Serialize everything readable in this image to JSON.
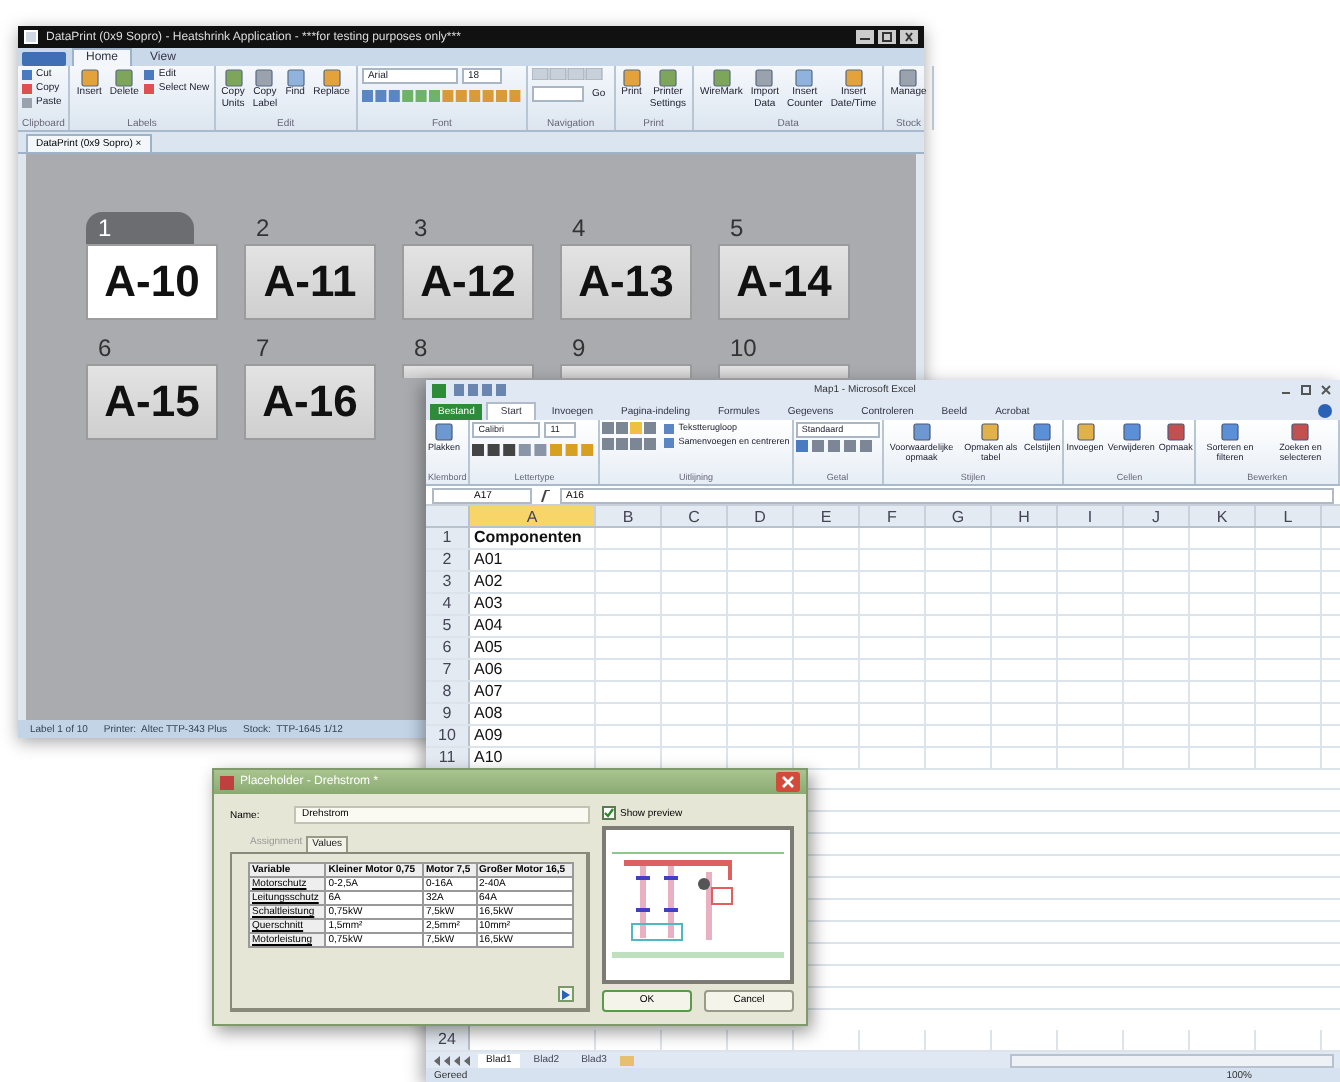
{
  "dataprint": {
    "title": "DataPrint (0x9 Sopro) - Heatshrink Application - ***for testing purposes only***",
    "tabs": [
      {
        "label": "Home",
        "selected": true
      },
      {
        "label": "View",
        "selected": false
      }
    ],
    "ribbon": [
      {
        "label": "Clipboard",
        "items": [
          {
            "kind": "stack",
            "labels": [
              "Cut",
              "Copy",
              "Paste"
            ]
          }
        ]
      },
      {
        "label": "Labels",
        "items": [
          {
            "kind": "large",
            "label": "Insert"
          },
          {
            "kind": "large",
            "label": "Delete"
          },
          {
            "kind": "stack",
            "labels": [
              "Edit",
              "Select New"
            ]
          }
        ]
      },
      {
        "label": "Edit",
        "items": [
          {
            "kind": "large",
            "label": "Copy Units"
          },
          {
            "kind": "large",
            "label": "Copy Label"
          },
          {
            "kind": "large",
            "label": "Find"
          },
          {
            "kind": "large",
            "label": "Replace"
          }
        ]
      },
      {
        "label": "Font",
        "items": [
          {
            "kind": "font",
            "font": "Arial",
            "size": "18"
          }
        ]
      },
      {
        "label": "Navigation",
        "items": [
          {
            "kind": "nav",
            "button": "Go"
          }
        ]
      },
      {
        "label": "Print",
        "items": [
          {
            "kind": "large",
            "label": "Print"
          },
          {
            "kind": "large",
            "label": "Printer Settings"
          }
        ]
      },
      {
        "label": "Data",
        "items": [
          {
            "kind": "large",
            "label": "WireMark"
          },
          {
            "kind": "large",
            "label": "Import Data"
          },
          {
            "kind": "large",
            "label": "Insert Counter"
          },
          {
            "kind": "large",
            "label": "Insert Date/Time"
          }
        ]
      },
      {
        "label": "Stock",
        "items": [
          {
            "kind": "large",
            "label": "Manage"
          }
        ]
      }
    ],
    "document_tab": "DataPrint (0x9 Sopro)",
    "document_tab_close": "×",
    "labels": [
      {
        "number": "1",
        "text": "A-10",
        "selected": true
      },
      {
        "number": "2",
        "text": "A-11",
        "selected": false
      },
      {
        "number": "3",
        "text": "A-12",
        "selected": false
      },
      {
        "number": "4",
        "text": "A-13",
        "selected": false
      },
      {
        "number": "5",
        "text": "A-14",
        "selected": false
      },
      {
        "number": "6",
        "text": "A-15",
        "selected": false
      },
      {
        "number": "7",
        "text": "A-16",
        "selected": false
      },
      {
        "number": "8",
        "selected": false
      },
      {
        "number": "9",
        "selected": false
      },
      {
        "number": "10",
        "selected": false
      }
    ],
    "status_bar": [
      "Label 1 of 10",
      "Printer:  Altec TTP-343 Plus",
      "Stock:  TTP-1645 1/12"
    ]
  },
  "excel": {
    "title": "Map1 - Microsoft Excel",
    "file_tab": "Bestand",
    "tabs": [
      {
        "label": "Start",
        "selected": true
      },
      {
        "label": "Invoegen",
        "selected": false
      },
      {
        "label": "Pagina-indeling",
        "selected": false
      },
      {
        "label": "Formules",
        "selected": false
      },
      {
        "label": "Gegevens",
        "selected": false
      },
      {
        "label": "Controleren",
        "selected": false
      },
      {
        "label": "Beeld",
        "selected": false
      },
      {
        "label": "Acrobat",
        "selected": false
      }
    ],
    "ribbon": [
      {
        "label": "Klembord",
        "items": [
          {
            "kind": "large",
            "label": "Plakken"
          }
        ]
      },
      {
        "label": "Lettertype",
        "items": [
          {
            "kind": "font",
            "font": "Calibri",
            "size": "11"
          }
        ]
      },
      {
        "label": "Uitlijning",
        "items": [
          {
            "kind": "align",
            "labels": [
              "Tekstterugloop",
              "Samenvoegen en centreren"
            ]
          }
        ]
      },
      {
        "label": "Getal",
        "items": [
          {
            "kind": "number",
            "value": "Standaard"
          }
        ]
      },
      {
        "label": "Stijlen",
        "items": [
          {
            "kind": "large",
            "label": "Voorwaardelijke opmaak"
          },
          {
            "kind": "large",
            "label": "Opmaken als tabel"
          },
          {
            "kind": "large",
            "label": "Celstijlen"
          }
        ]
      },
      {
        "label": "Cellen",
        "items": [
          {
            "kind": "large",
            "label": "Invoegen"
          },
          {
            "kind": "large",
            "label": "Verwijderen"
          },
          {
            "kind": "large",
            "label": "Opmaak"
          }
        ]
      },
      {
        "label": "Bewerken",
        "items": [
          {
            "kind": "large",
            "label": "Sorteren en filteren"
          },
          {
            "kind": "large",
            "label": "Zoeken en selecteren"
          }
        ]
      }
    ],
    "name_box": "A17",
    "formula": "A16",
    "columns": [
      {
        "label": "A",
        "selected": true
      },
      {
        "label": "B",
        "selected": false
      },
      {
        "label": "C",
        "selected": false
      },
      {
        "label": "D",
        "selected": false
      },
      {
        "label": "E",
        "selected": false
      },
      {
        "label": "F",
        "selected": false
      },
      {
        "label": "G",
        "selected": false
      },
      {
        "label": "H",
        "selected": false
      },
      {
        "label": "I",
        "selected": false
      },
      {
        "label": "J",
        "selected": false
      },
      {
        "label": "K",
        "selected": false
      },
      {
        "label": "L",
        "selected": false
      }
    ],
    "rows": [
      {
        "number": "1",
        "value": "Componenten",
        "bold": true
      },
      {
        "number": "2",
        "value": "A01",
        "bold": false
      },
      {
        "number": "3",
        "value": "A02",
        "bold": false
      },
      {
        "number": "4",
        "value": "A03",
        "bold": false
      },
      {
        "number": "5",
        "value": "A04",
        "bold": false
      },
      {
        "number": "6",
        "value": "A05",
        "bold": false
      },
      {
        "number": "7",
        "value": "A06",
        "bold": false
      },
      {
        "number": "8",
        "value": "A07",
        "bold": false
      },
      {
        "number": "9",
        "value": "A08",
        "bold": false
      },
      {
        "number": "10",
        "value": "A09",
        "bold": false
      },
      {
        "number": "11",
        "value": "A10",
        "bold": false
      }
    ],
    "last_row": "24",
    "sheet_tabs": [
      {
        "label": "Blad1",
        "selected": true
      },
      {
        "label": "Blad2",
        "selected": false
      },
      {
        "label": "Blad3",
        "selected": false
      }
    ],
    "status": "Gereed",
    "zoom": "100%"
  },
  "dialog": {
    "title": "Placeholder - Drehstrom *",
    "name_label": "Name:",
    "name_value": "Drehstrom",
    "show_preview": {
      "label": "Show preview",
      "checked": true
    },
    "tabs": [
      {
        "label": "Assignment",
        "selected": false
      },
      {
        "label": "Values",
        "selected": true
      }
    ],
    "table": {
      "columns": [
        "Variable",
        "Kleiner Motor 0,75",
        "Motor 7,5",
        "Großer Motor 16,5"
      ],
      "rows": [
        [
          "Motorschutz",
          "0-2,5A",
          "0-16A",
          "2-40A"
        ],
        [
          "Leitungsschutz",
          "6A",
          "32A",
          "64A"
        ],
        [
          "Schaltleistung",
          "0,75kW",
          "7,5kW",
          "16,5kW"
        ],
        [
          "Querschnitt",
          "1,5mm²",
          "2,5mm²",
          "10mm²"
        ],
        [
          "Motorleistung",
          "0,75kW",
          "7,5kW",
          "16,5kW"
        ]
      ]
    },
    "buttons": [
      "OK",
      "Cancel"
    ]
  }
}
